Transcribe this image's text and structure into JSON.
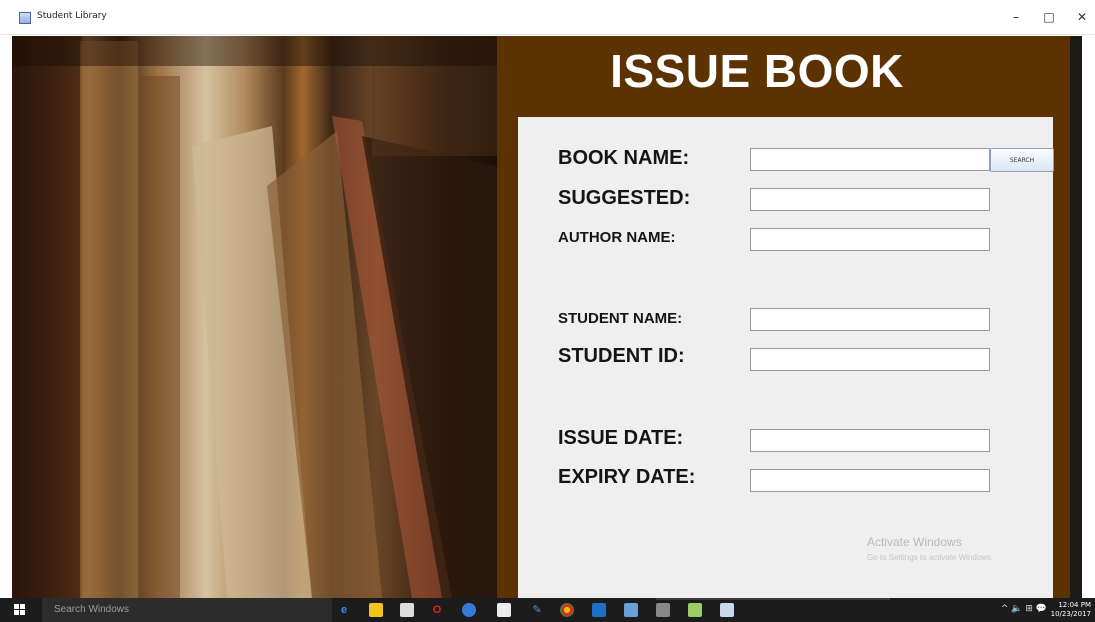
{
  "window": {
    "title": "Student Library",
    "minimize": "–",
    "maximize": "□",
    "close": "✕"
  },
  "form": {
    "heading": "ISSUE BOOK",
    "search_button": "SEARCH",
    "fields": {
      "book_name": {
        "label": "BOOK NAME:",
        "value": ""
      },
      "suggested": {
        "label": "SUGGESTED:",
        "value": ""
      },
      "author_name": {
        "label": "AUTHOR NAME:",
        "value": ""
      },
      "student_name": {
        "label": "STUDENT NAME:",
        "value": ""
      },
      "student_id": {
        "label": "STUDENT ID:",
        "value": ""
      },
      "issue_date": {
        "label": "ISSUE DATE:",
        "value": ""
      },
      "expiry_date": {
        "label": "EXPIRY DATE:",
        "value": ""
      }
    }
  },
  "watermark": {
    "line1": "Activate Windows",
    "line2": "Go to Settings to activate Windows."
  },
  "taskbar": {
    "search_placeholder": "Search Windows",
    "apps": [
      "edge-icon",
      "file-explorer-icon",
      "store-icon",
      "opera-icon",
      "photos-icon",
      "camera-icon",
      "paint-icon",
      "chrome-icon",
      "outlook-icon",
      "netbeans-icon",
      "terminal-icon",
      "tool-icon",
      "java-app-icon"
    ],
    "tray_text": "^ 🔈 ⊞ 💬",
    "time": "12:04 PM",
    "date": "10/23/2017"
  }
}
